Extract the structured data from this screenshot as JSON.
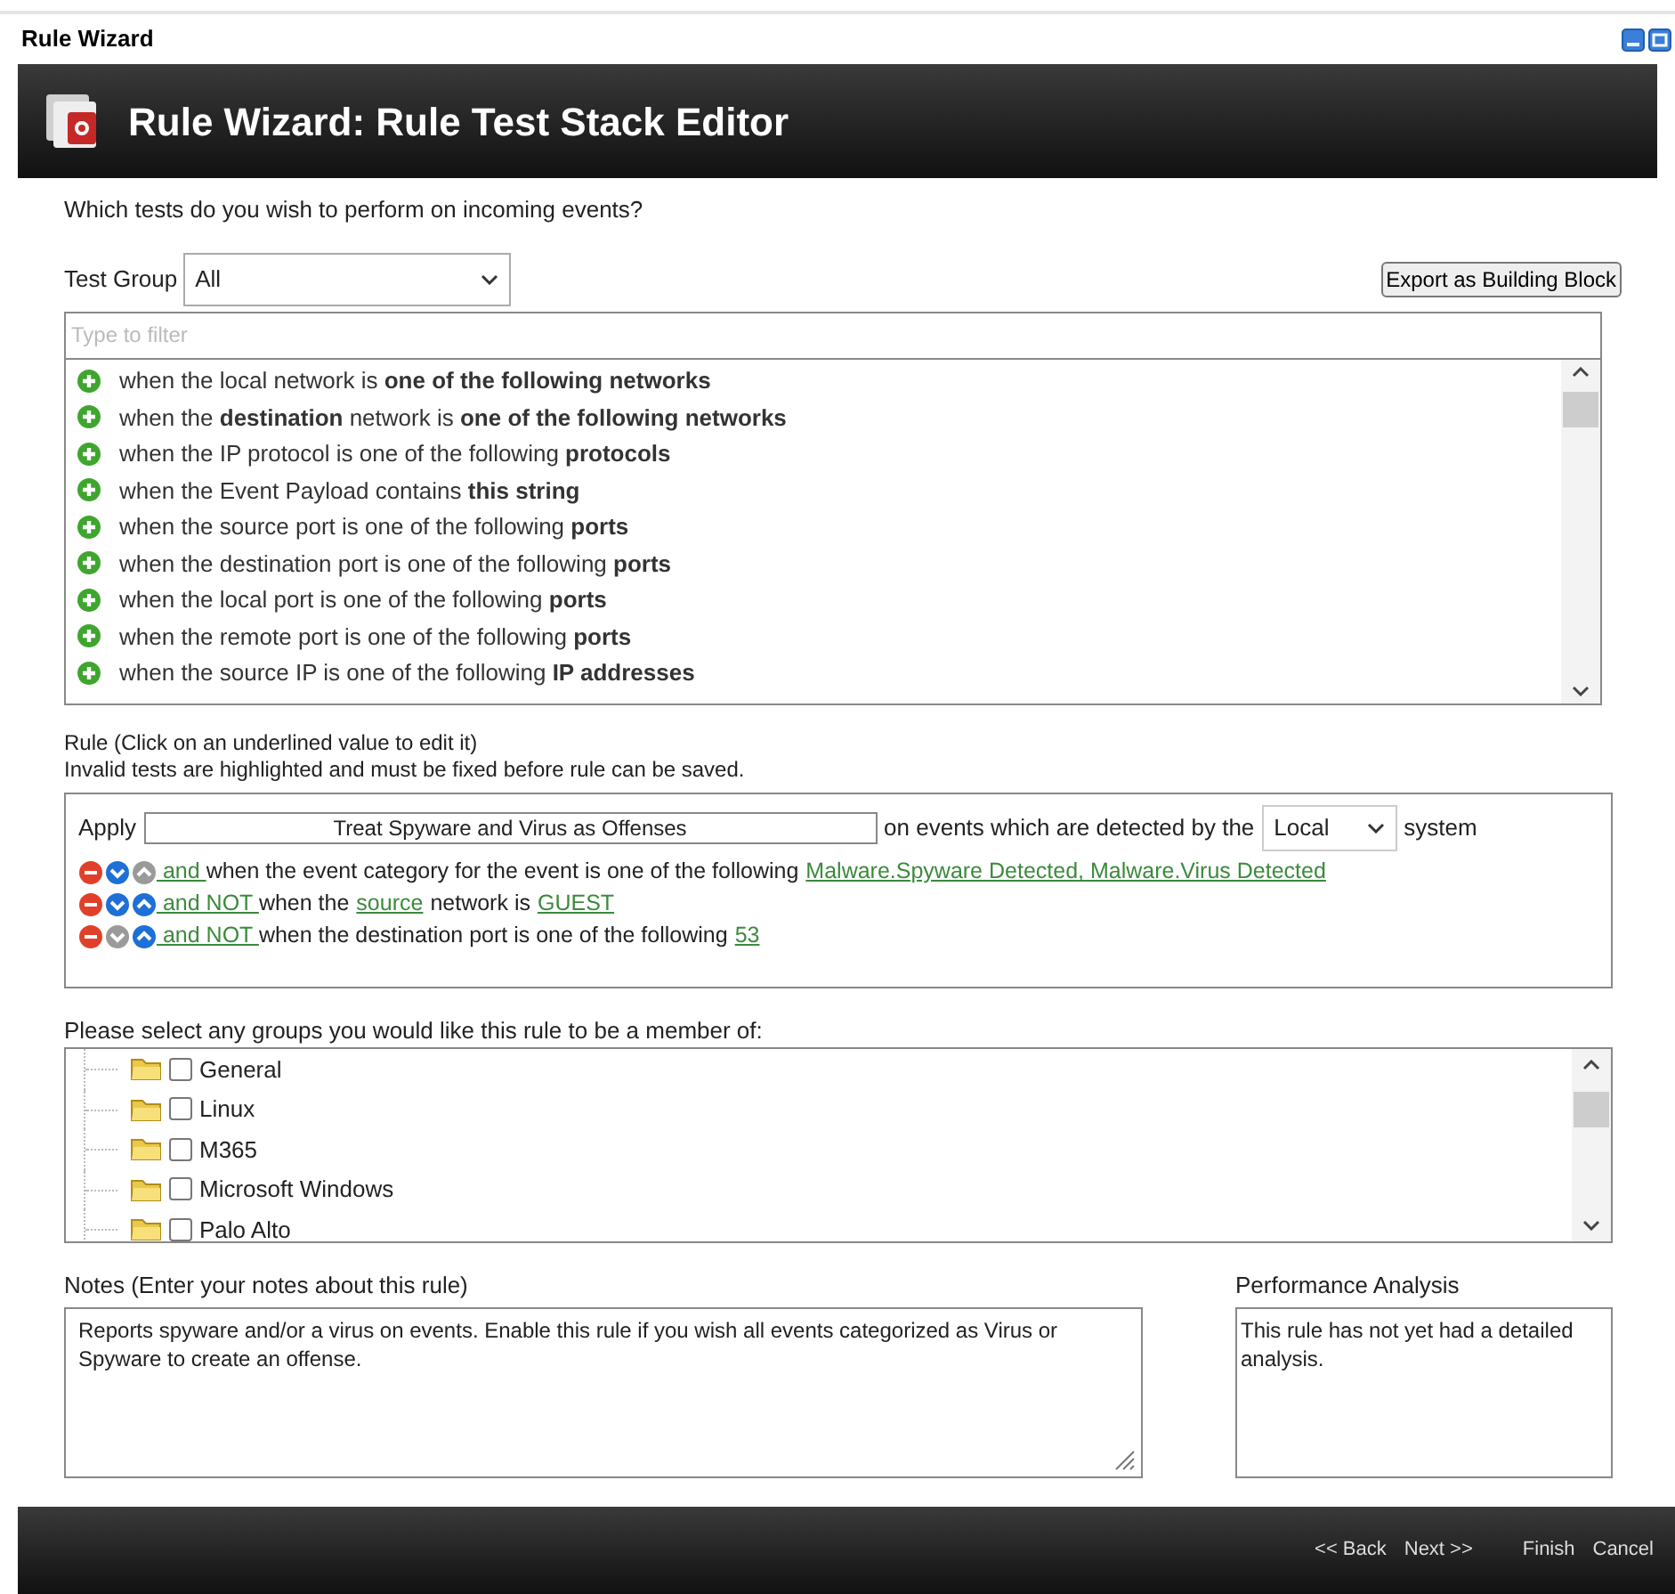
{
  "window": {
    "title": "Rule Wizard"
  },
  "header": {
    "title": "Rule Wizard: Rule Test Stack Editor"
  },
  "prompt": "Which tests do you wish to perform on incoming events?",
  "test_group": {
    "label": "Test Group",
    "value": "All"
  },
  "export_button": "Export as Building Block",
  "filter": {
    "placeholder": "Type to filter"
  },
  "tests": [
    "when the local network is **one of the following networks**",
    "when the **destination** network is **one of the following networks**",
    "when the IP protocol is one of the following **protocols**",
    "when the Event Payload contains **this string**",
    "when the source port is one of the following **ports**",
    "when the destination port is one of the following **ports**",
    "when the local port is one of the following **ports**",
    "when the remote port is one of the following **ports**",
    "when the source IP is one of the following **IP addresses**"
  ],
  "rule_help": [
    "Rule (Click on an underlined value to edit it)",
    "Invalid tests are highlighted and must be fixed before rule can be saved."
  ],
  "rule": {
    "apply_label": "Apply",
    "name": "Treat Spyware and Virus as Offenses",
    "middle_text": "on events which are detected by the",
    "system": "Local",
    "end_text": "system",
    "lines": [
      {
        "move_down_enabled": true,
        "move_up_enabled": false,
        "segments": [
          {
            "text": " and ",
            "link": true
          },
          {
            "text": "when the event category for the event is one of the following",
            "link": false
          },
          {
            "text": "Malware.Spyware Detected, Malware.Virus Detected",
            "link": true
          }
        ]
      },
      {
        "move_down_enabled": true,
        "move_up_enabled": true,
        "segments": [
          {
            "text": " and NOT ",
            "link": true
          },
          {
            "text": "when the",
            "link": false
          },
          {
            "text": "source",
            "link": true
          },
          {
            "text": "network is",
            "link": false
          },
          {
            "text": "GUEST",
            "link": true
          }
        ]
      },
      {
        "move_down_enabled": false,
        "move_up_enabled": true,
        "segments": [
          {
            "text": " and NOT ",
            "link": true
          },
          {
            "text": "when the destination port is one of the following",
            "link": false
          },
          {
            "text": "53",
            "link": true
          }
        ]
      }
    ]
  },
  "groups_label": "Please select any groups you would like this rule to be a member of:",
  "groups": [
    {
      "label": "General",
      "checked": false
    },
    {
      "label": "Linux",
      "checked": false
    },
    {
      "label": "M365",
      "checked": false
    },
    {
      "label": "Microsoft Windows",
      "checked": false
    },
    {
      "label": "Palo Alto",
      "checked": false
    }
  ],
  "notes": {
    "label": "Notes (Enter your notes about this rule)",
    "value": "Reports spyware and/or a virus on events. Enable this rule if you wish all events categorized as Virus or Spyware to create an offense."
  },
  "performance": {
    "label": "Performance Analysis",
    "value": "This rule has not yet had a detailed analysis."
  },
  "footer_buttons": [
    "<< Back",
    "Next >>",
    "Finish",
    "Cancel"
  ]
}
